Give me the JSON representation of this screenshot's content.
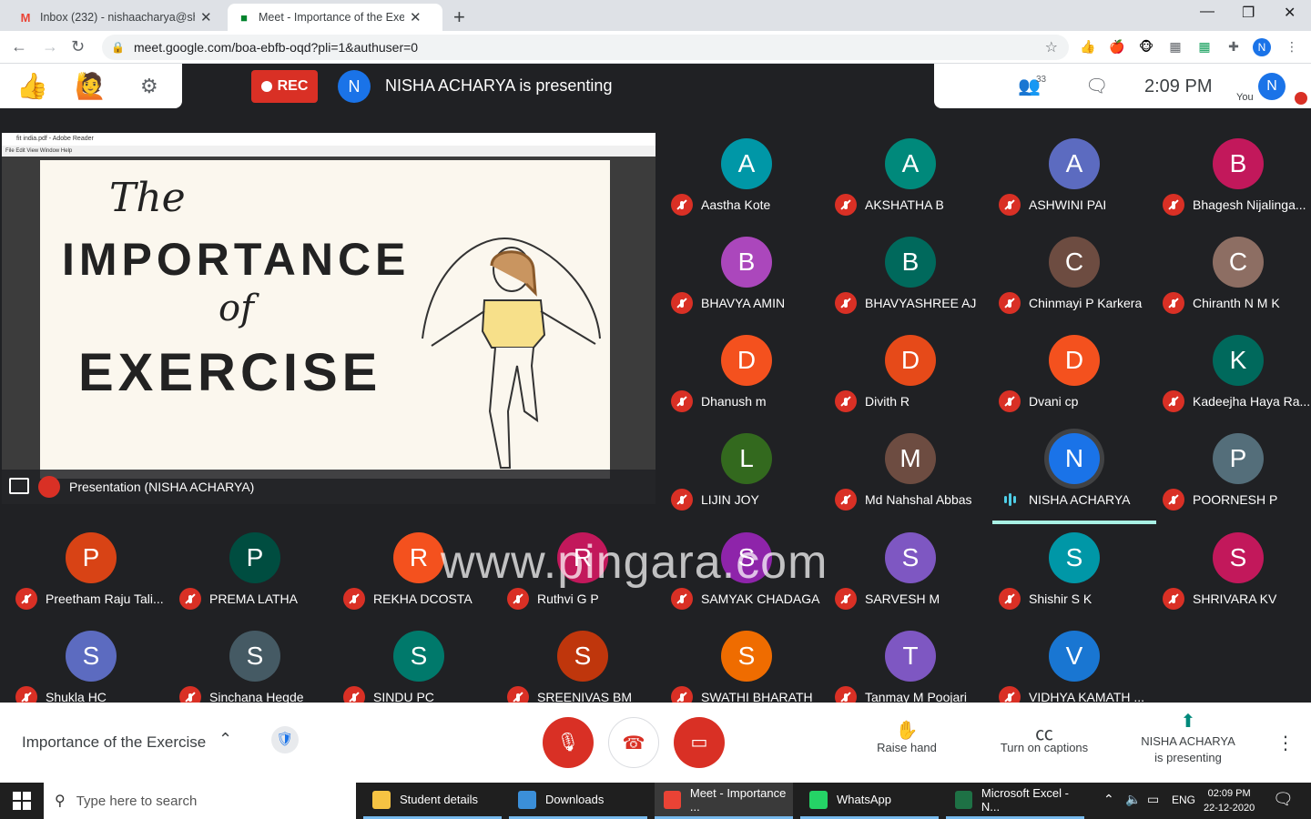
{
  "browser": {
    "tabs": [
      {
        "title": "Inbox (232) - nishaacharya@shak",
        "icon": "gmail-icon",
        "active": false
      },
      {
        "title": "Meet - Importance of the Exe",
        "icon": "meet-icon",
        "active": true
      }
    ],
    "url": "meet.google.com/boa-ebfb-oqd?pli=1&authuser=0",
    "profile_initial": "N"
  },
  "meet": {
    "rec_label": "REC",
    "presenter_initial": "N",
    "presenting_text": "NISHA ACHARYA is presenting",
    "participant_count": "33",
    "clock": "2:09 PM",
    "you_label": "You",
    "you_initial": "N",
    "presentation": {
      "reader_title": "fit india.pdf - Adobe Reader",
      "reader_menu": "File   Edit   View   Window   Help",
      "slide_the": "The",
      "slide_importance": "IMPORTANCE",
      "slide_of": "of",
      "slide_exercise": "EXERCISE",
      "label": "Presentation (NISHA ACHARYA)"
    },
    "participants": [
      {
        "initial": "A",
        "name": "Aastha Kote",
        "color": "#0097a7"
      },
      {
        "initial": "A",
        "name": "AKSHATHA B",
        "color": "#00897b"
      },
      {
        "initial": "A",
        "name": "ASHWINI PAI",
        "color": "#5c6bc0"
      },
      {
        "initial": "B",
        "name": "Bhagesh Nijalinga...",
        "color": "#c2185b"
      },
      {
        "initial": "B",
        "name": "BHAVYA AMIN",
        "color": "#ab47bc"
      },
      {
        "initial": "B",
        "name": "BHAVYASHREE AJ",
        "color": "#00695c"
      },
      {
        "initial": "C",
        "name": "Chinmayi P Karkera",
        "color": "#6d4c41"
      },
      {
        "initial": "C",
        "name": "Chiranth N M K",
        "color": "#8d6e63"
      },
      {
        "initial": "D",
        "name": "Dhanush m",
        "color": "#f4511e"
      },
      {
        "initial": "D",
        "name": "Divith R",
        "color": "#e64a19"
      },
      {
        "initial": "D",
        "name": "Dvani cp",
        "color": "#f4511e"
      },
      {
        "initial": "K",
        "name": "Kadeejha Haya Ra...",
        "color": "#00695c"
      },
      {
        "initial": "L",
        "name": "LIJIN JOY",
        "color": "#33691e"
      },
      {
        "initial": "M",
        "name": "Md Nahshal Abbas",
        "color": "#6d4c41"
      },
      {
        "initial": "N",
        "name": "NISHA ACHARYA",
        "color": "#1a73e8"
      },
      {
        "initial": "P",
        "name": "POORNESH P",
        "color": "#546e7a"
      },
      {
        "initial": "P",
        "name": "Preetham Raju Tali...",
        "color": "#d84315"
      },
      {
        "initial": "P",
        "name": "PREMA LATHA",
        "color": "#004d40"
      },
      {
        "initial": "R",
        "name": "REKHA DCOSTA",
        "color": "#f4511e"
      },
      {
        "initial": "R",
        "name": "Ruthvi G P",
        "color": "#c2185b"
      },
      {
        "initial": "S",
        "name": "SAMYAK CHADAGA",
        "color": "#8e24aa"
      },
      {
        "initial": "S",
        "name": "SARVESH M",
        "color": "#7e57c2"
      },
      {
        "initial": "S",
        "name": "Shishir S K",
        "color": "#0097a7"
      },
      {
        "initial": "S",
        "name": "SHRIVARA KV",
        "color": "#c2185b"
      },
      {
        "initial": "S",
        "name": "Shukla HC",
        "color": "#5c6bc0"
      },
      {
        "initial": "S",
        "name": "Sinchana Hegde",
        "color": "#455a64"
      },
      {
        "initial": "S",
        "name": "SINDU PC",
        "color": "#00796b"
      },
      {
        "initial": "S",
        "name": "SREENIVAS BM",
        "color": "#bf360c"
      },
      {
        "initial": "S",
        "name": "SWATHI BHARATH",
        "color": "#ef6c00"
      },
      {
        "initial": "T",
        "name": "Tanmay M Poojari",
        "color": "#7e57c2"
      },
      {
        "initial": "V",
        "name": "VIDHYA KAMATH ...",
        "color": "#1976d2"
      }
    ],
    "watermark": "www.pingara.com"
  },
  "bottombar": {
    "meeting_title": "Importance of the Exercise",
    "raise_hand": "Raise hand",
    "captions": "Turn on captions",
    "presenting_line1": "NISHA ACHARYA",
    "presenting_line2": "is presenting"
  },
  "taskbar": {
    "search_placeholder": "Type here to search",
    "apps": [
      {
        "label": "Student details",
        "color": "#f6c343"
      },
      {
        "label": "Downloads",
        "color": "#3b8fd9"
      },
      {
        "label": "Meet - Importance ...",
        "color": "#ea4335"
      },
      {
        "label": "WhatsApp",
        "color": "#25d366"
      },
      {
        "label": "Microsoft Excel - N...",
        "color": "#1e7145"
      }
    ],
    "lang": "ENG",
    "time": "02:09 PM",
    "date": "22-12-2020"
  }
}
